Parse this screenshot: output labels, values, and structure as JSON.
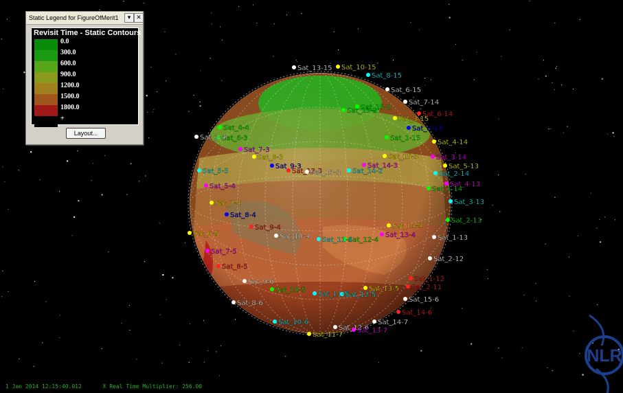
{
  "legend": {
    "window_title": "Static Legend for FigureOfMerit1",
    "dropdown_icon": "chevron-down-icon",
    "close_icon": "close-icon",
    "heading": "Revisit Time - Static Contours",
    "levels": [
      {
        "label": "0.0",
        "color": "#0a8a0a"
      },
      {
        "label": "300.0",
        "color": "#1a9a12"
      },
      {
        "label": "600.0",
        "color": "#56a51a"
      },
      {
        "label": "900.0",
        "color": "#8a9a1e"
      },
      {
        "label": "1200.0",
        "color": "#a0801e"
      },
      {
        "label": "1500.0",
        "color": "#a0561c"
      },
      {
        "label": "1800.0",
        "color": "#a01a1a"
      },
      {
        "label": "+",
        "color": "#000000"
      }
    ],
    "layout_button": "Layout..."
  },
  "status": {
    "time": "1 Jan 2014 12:15:40.012",
    "multiplier": "X Real Time Multiplier: 256.00"
  },
  "logo": {
    "text": "NLR",
    "color": "#1c3f8c"
  },
  "satellites": [
    {
      "label": "Sat_13-15",
      "color": "#ffffff"
    },
    {
      "label": "Sat_10-15",
      "color": "#ffff00"
    },
    {
      "label": "Sat_8-15",
      "color": "#00ffff"
    },
    {
      "label": "Sat_6-15",
      "color": "#ffffff"
    },
    {
      "label": "Sat_7-14",
      "color": "#ffffff"
    },
    {
      "label": "Sat_6-14",
      "color": "#ff2020"
    },
    {
      "label": "Sat_3-15",
      "color": "#ffff00"
    },
    {
      "label": "Sat_3-14",
      "color": "#0000ff"
    },
    {
      "label": "Sat_1-15",
      "color": "#00ff00"
    },
    {
      "label": "Sat_4-14",
      "color": "#ffff00"
    },
    {
      "label": "Sat_3-14",
      "color": "#ff00ff"
    },
    {
      "label": "Sat_5-13",
      "color": "#ffff00"
    },
    {
      "label": "Sat_2-14",
      "color": "#00ffff"
    },
    {
      "label": "Sat_4-13",
      "color": "#ff00ff"
    },
    {
      "label": "Sat_1-14",
      "color": "#00ff00"
    },
    {
      "label": "Sat_3-13",
      "color": "#00ffff"
    },
    {
      "label": "Sat_2-13",
      "color": "#00ff00"
    },
    {
      "label": "Sat_1-13",
      "color": "#ffffff"
    },
    {
      "label": "Sat_2-12",
      "color": "#ffffff"
    },
    {
      "label": "Sat_1-12",
      "color": "#ff2020"
    },
    {
      "label": "Sat_2-11",
      "color": "#ff2020"
    },
    {
      "label": "Sat_15-6",
      "color": "#ffffff"
    },
    {
      "label": "Sat_14-6",
      "color": "#ff2020"
    },
    {
      "label": "Sat_14-7",
      "color": "#ffffff"
    },
    {
      "label": "Sat_11-7",
      "color": "#ffff00"
    },
    {
      "label": "Sat_12-6",
      "color": "#ffffff"
    },
    {
      "label": "Sat_13-7",
      "color": "#ff00ff"
    },
    {
      "label": "Sat_10-6",
      "color": "#00ffff"
    },
    {
      "label": "Sat_8-6",
      "color": "#ffffff"
    },
    {
      "label": "Sat_9-6",
      "color": "#ffffff"
    },
    {
      "label": "Sat_13-5",
      "color": "#ffff00"
    },
    {
      "label": "Sat_12-5",
      "color": "#00ffff"
    },
    {
      "label": "Sat_11-5",
      "color": "#00ffff"
    },
    {
      "label": "Sat_10-5",
      "color": "#00ff00"
    },
    {
      "label": "Sat_14-4",
      "color": "#ffff00"
    },
    {
      "label": "Sat_13-4",
      "color": "#ff00ff"
    },
    {
      "label": "Sat_12-4",
      "color": "#00ff00"
    },
    {
      "label": "Sat_11-4",
      "color": "#00ffff"
    },
    {
      "label": "Sat_10-4",
      "color": "#ffffff"
    },
    {
      "label": "Sat_9-4",
      "color": "#ff2020"
    },
    {
      "label": "Sat_8-5",
      "color": "#ff2020"
    },
    {
      "label": "Sat_7-5",
      "color": "#ff00ff"
    },
    {
      "label": "Sat_6-5",
      "color": "#ffff00"
    },
    {
      "label": "Sat_7-4",
      "color": "#ffff00"
    },
    {
      "label": "Sat_8-4",
      "color": "#0000ff"
    },
    {
      "label": "Sat_5-4",
      "color": "#ff00ff"
    },
    {
      "label": "Sat_5-5",
      "color": "#00ffff"
    },
    {
      "label": "Sat_8-3",
      "color": "#ffff00"
    },
    {
      "label": "Sat_9-3",
      "color": "#0000ff"
    },
    {
      "label": "Sat_7-3",
      "color": "#ff00ff"
    },
    {
      "label": "Sat_6-3",
      "color": "#00ff00"
    },
    {
      "label": "Sat_3-4",
      "color": "#ffffff"
    },
    {
      "label": "Sat_4-4",
      "color": "#00ff00"
    },
    {
      "label": "Sat_12-3",
      "color": "#ff2020"
    },
    {
      "label": "Sat_13-3",
      "color": "#ffffff"
    },
    {
      "label": "Sat_15-3",
      "color": "#ffff00"
    },
    {
      "label": "Sat_14-3",
      "color": "#ff00ff"
    },
    {
      "label": "Sat_13-2",
      "color": "#00ff00"
    },
    {
      "label": "Sat_15-2",
      "color": "#00ff00"
    },
    {
      "label": "Sat_14-2",
      "color": "#00ffff"
    }
  ]
}
